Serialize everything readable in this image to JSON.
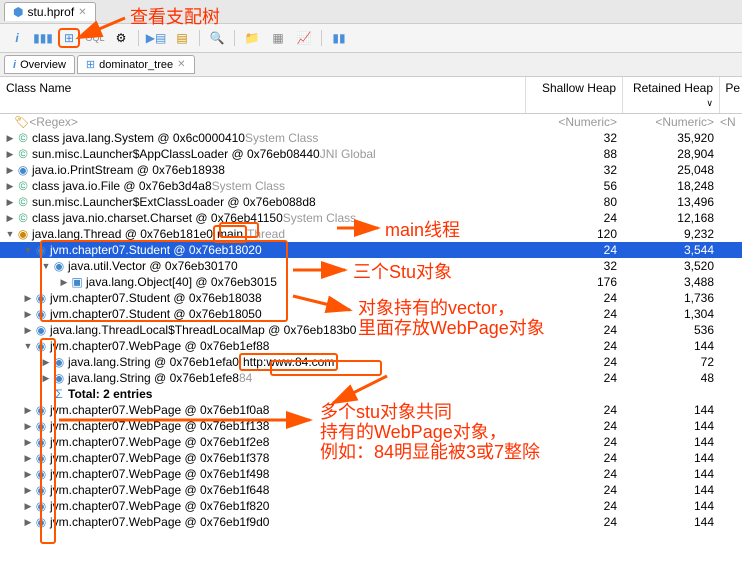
{
  "fileTab": {
    "name": "stu.hprof"
  },
  "subTabs": {
    "overview": "Overview",
    "dominator": "dominator_tree"
  },
  "columns": {
    "name": "Class Name",
    "shallow": "Shallow Heap",
    "retained": "Retained Heap",
    "pe": "Pe"
  },
  "regex": {
    "label": "<Regex>",
    "shallow": "<Numeric>",
    "retained": "<Numeric>",
    "pe": "<N"
  },
  "rows": [
    {
      "d": 0,
      "e": "▶",
      "ic": "C",
      "t": "class java.lang.System @ 0x6c0000410",
      "suf": "System Class",
      "s": "32",
      "r": "35,920"
    },
    {
      "d": 0,
      "e": "▶",
      "ic": "C",
      "t": "sun.misc.Launcher$AppClassLoader @ 0x76eb08440",
      "suf": "JNI Global",
      "s": "88",
      "r": "28,904"
    },
    {
      "d": 0,
      "e": "▶",
      "ic": "O",
      "t": "java.io.PrintStream @ 0x76eb18938",
      "s": "32",
      "r": "25,048"
    },
    {
      "d": 0,
      "e": "▶",
      "ic": "C",
      "t": "class java.io.File @ 0x76eb3d4a8",
      "suf": "System Class",
      "s": "56",
      "r": "18,248"
    },
    {
      "d": 0,
      "e": "▶",
      "ic": "C",
      "t": "sun.misc.Launcher$ExtClassLoader @ 0x76eb088d8",
      "s": "80",
      "r": "13,496"
    },
    {
      "d": 0,
      "e": "▶",
      "ic": "C",
      "t": "class java.nio.charset.Charset @ 0x76eb41150",
      "suf": "System Class",
      "s": "24",
      "r": "12,168"
    },
    {
      "d": 0,
      "e": "▼",
      "ic": "T",
      "t": "java.lang.Thread @ 0x76eb181e0",
      "box1": "main",
      "suf": "Thread",
      "s": "120",
      "r": "9,232"
    },
    {
      "d": 1,
      "e": "▼",
      "ic": "O",
      "sel": true,
      "t": "jvm.chapter07.Student @ 0x76eb18020",
      "s": "24",
      "r": "3,544"
    },
    {
      "d": 2,
      "e": "▼",
      "ic": "O",
      "t": "java.util.Vector @ 0x76eb30170",
      "s": "32",
      "r": "3,520"
    },
    {
      "d": 3,
      "e": "▶",
      "ic": "A",
      "t": "java.lang.Object[40] @ 0x76eb3015",
      "s": "176",
      "r": "3,488"
    },
    {
      "d": 1,
      "e": "▶",
      "ic": "O",
      "t": "jvm.chapter07.Student @ 0x76eb18038",
      "s": "24",
      "r": "1,736"
    },
    {
      "d": 1,
      "e": "▶",
      "ic": "O",
      "t": "jvm.chapter07.Student @ 0x76eb18050",
      "s": "24",
      "r": "1,304"
    },
    {
      "d": 1,
      "e": "▶",
      "ic": "O",
      "t": "java.lang.ThreadLocal$ThreadLocalMap @ 0x76eb183b0",
      "s": "24",
      "r": "536"
    },
    {
      "d": 1,
      "e": "▼",
      "ic": "O",
      "t": "jvm.chapter07.WebPage @ 0x76eb1ef88",
      "s": "24",
      "r": "144"
    },
    {
      "d": 2,
      "e": "▶",
      "ic": "O",
      "t": "java.lang.String @ 0x76eb1efa0",
      "box1": "http:www.84.com",
      "s": "24",
      "r": "72"
    },
    {
      "d": 2,
      "e": "▶",
      "ic": "O",
      "t": "java.lang.String @ 0x76eb1efe8",
      "suf2": "84",
      "s": "24",
      "r": "48"
    },
    {
      "d": 2,
      "e": "",
      "ic": "S",
      "bold": true,
      "t": "Total: 2 entries",
      "s": "",
      "r": ""
    },
    {
      "d": 1,
      "e": "▶",
      "ic": "O",
      "t": "jvm.chapter07.WebPage @ 0x76eb1f0a8",
      "s": "24",
      "r": "144"
    },
    {
      "d": 1,
      "e": "▶",
      "ic": "O",
      "t": "jvm.chapter07.WebPage @ 0x76eb1f138",
      "s": "24",
      "r": "144"
    },
    {
      "d": 1,
      "e": "▶",
      "ic": "O",
      "t": "jvm.chapter07.WebPage @ 0x76eb1f2e8",
      "s": "24",
      "r": "144"
    },
    {
      "d": 1,
      "e": "▶",
      "ic": "O",
      "t": "jvm.chapter07.WebPage @ 0x76eb1f378",
      "s": "24",
      "r": "144"
    },
    {
      "d": 1,
      "e": "▶",
      "ic": "O",
      "t": "jvm.chapter07.WebPage @ 0x76eb1f498",
      "s": "24",
      "r": "144"
    },
    {
      "d": 1,
      "e": "▶",
      "ic": "O",
      "t": "jvm.chapter07.WebPage @ 0x76eb1f648",
      "s": "24",
      "r": "144"
    },
    {
      "d": 1,
      "e": "▶",
      "ic": "O",
      "t": "jvm.chapter07.WebPage @ 0x76eb1f820",
      "s": "24",
      "r": "144"
    },
    {
      "d": 1,
      "e": "▶",
      "ic": "O",
      "t": "jvm.chapter07.WebPage @ 0x76eb1f9d0",
      "s": "24",
      "r": "144"
    }
  ],
  "annotations": {
    "a1": "查看支配树",
    "a2": "main线程",
    "a3": "三个Stu对象",
    "a4": "对象持有的vector，",
    "a4b": "里面存放WebPage对象",
    "a5": "多个stu对象共同",
    "a5b": "持有的WebPage对象，",
    "a5c": "例如：84明显能被3或7整除"
  },
  "icons": {
    "db": "🗄",
    "info": "i",
    "chart": "📊",
    "tree": "🌳",
    "gear": "⚙",
    "filter": "▤",
    "search": "🔍"
  }
}
